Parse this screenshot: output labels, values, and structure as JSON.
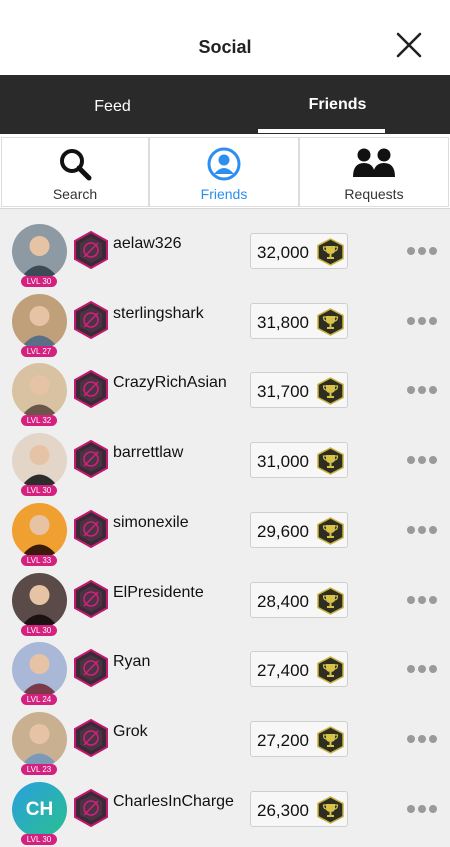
{
  "header": {
    "title": "Social"
  },
  "tabs": [
    {
      "label": "Feed"
    },
    {
      "label": "Friends"
    }
  ],
  "subnav": [
    {
      "label": "Search",
      "icon": "search-icon"
    },
    {
      "label": "Friends",
      "icon": "friends-icon",
      "active": true
    },
    {
      "label": "Requests",
      "icon": "requests-icon"
    }
  ],
  "colors": {
    "accent": "#2b8ef0",
    "tabbar": "#2a2a2a",
    "level_badge": "#d4207f",
    "badge": "#c2186f"
  },
  "friends": [
    {
      "name": "aelaw326",
      "level": "LVL 30",
      "score": "32,000"
    },
    {
      "name": "sterlingshark",
      "level": "LVL 27",
      "score": "31,800"
    },
    {
      "name": "CrazyRichAsian",
      "level": "LVL 32",
      "score": "31,700"
    },
    {
      "name": "barrettlaw",
      "level": "LVL 30",
      "score": "31,000"
    },
    {
      "name": "simonexile",
      "level": "LVL 33",
      "score": "29,600"
    },
    {
      "name": "ElPresidente",
      "level": "LVL 30",
      "score": "28,400"
    },
    {
      "name": "Ryan",
      "level": "LVL 24",
      "score": "27,400"
    },
    {
      "name": "Grok",
      "level": "LVL 23",
      "score": "27,200"
    },
    {
      "name": "CharlesInCharge",
      "level": "LVL 30",
      "score": "26,300",
      "initials": "CH"
    }
  ]
}
